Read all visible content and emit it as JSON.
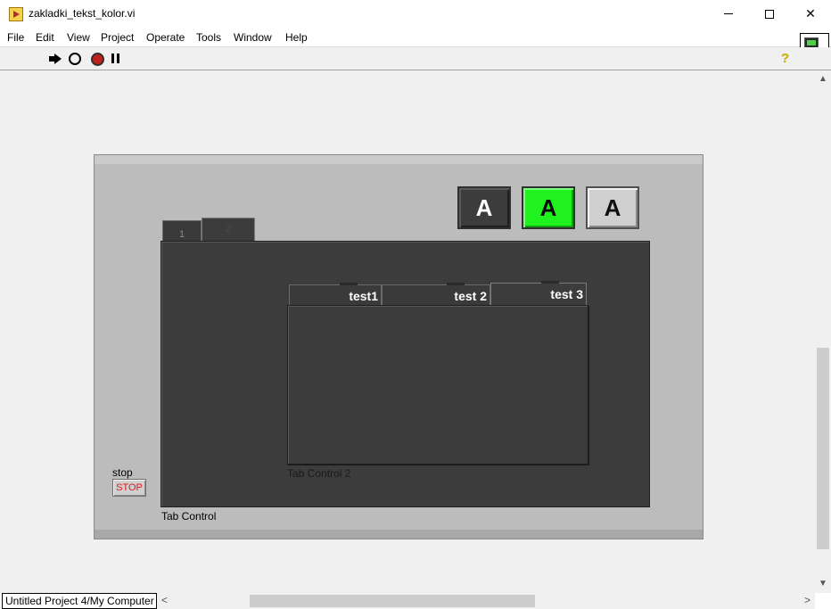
{
  "window": {
    "title": "zakladki_tekst_kolor.vi",
    "minimize_glyph": "",
    "close_glyph": "✕"
  },
  "menu": [
    {
      "label": "File"
    },
    {
      "label": "Edit"
    },
    {
      "label": "View"
    },
    {
      "label": "Project"
    },
    {
      "label": "Operate"
    },
    {
      "label": "Tools"
    },
    {
      "label": "Window"
    },
    {
      "label": "Help"
    }
  ],
  "toolbar": {
    "help_glyph": "?",
    "vi_icon_number": "2"
  },
  "panel": {
    "bool_buttons": [
      {
        "label": "A",
        "color": "#3c3c3c",
        "text_color": "#ffffff"
      },
      {
        "label": "A",
        "color": "#1ff21f",
        "text_color": "#0a0a0a"
      },
      {
        "label": "A",
        "color": "#cfcfcf",
        "text_color": "#101010"
      }
    ],
    "tab_control": {
      "caption": "Tab Control",
      "tabs": [
        {
          "label": "1"
        },
        {
          "label": "2"
        }
      ]
    },
    "tab_control_2": {
      "caption": "Tab Control 2",
      "tabs": [
        {
          "label": "test1"
        },
        {
          "label": "test 2"
        },
        {
          "label": "test 3"
        }
      ]
    },
    "stop": {
      "label": "stop",
      "button_text": "STOP",
      "text_color": "#e01818"
    }
  },
  "scrollbars": {
    "up": "▲",
    "down": "▼",
    "left": "<",
    "right": ">"
  },
  "status": {
    "context": "Untitled Project 4/My Computer"
  }
}
